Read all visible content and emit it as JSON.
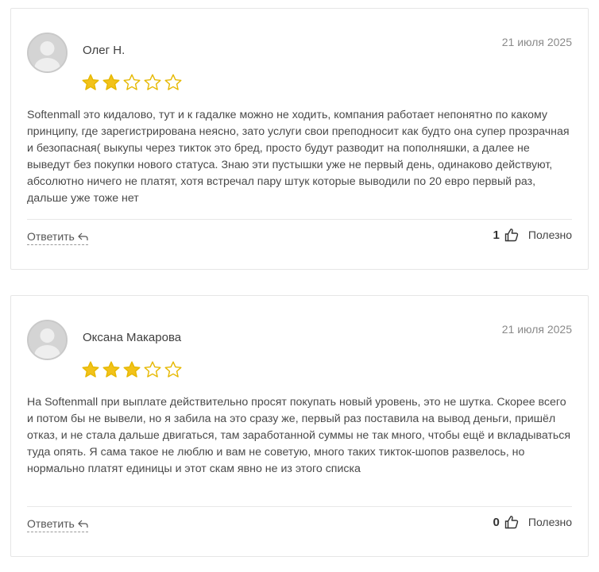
{
  "reviews": [
    {
      "author": "Олег Н.",
      "date": "21 июля 2025",
      "rating": 2,
      "max_rating": 5,
      "text": "Softenmall это кидалово, тут и к гадалке можно не ходить, компания работает непонятно по какому принципу, где зарегистрирована неясно, зато услуги свои преподносит как будто она супер прозрачная и безопасная( выкупы через тикток это бред, просто будут разводит на пополняшки, а далее не выведут без покупки нового статуса. Знаю эти пустышки уже не первый день, одинаково действуют, абсолютно ничего не платят, хотя встречал пару штук которые выводили по 20 евро первый раз, дальше уже тоже нет",
      "reply_label": "Ответить",
      "helpful_count": "1",
      "helpful_label": "Полезно"
    },
    {
      "author": "Оксана Макарова",
      "date": "21 июля 2025",
      "rating": 3,
      "max_rating": 5,
      "text": "На Softenmall при выплате действительно просят покупать новый уровень, это не шутка. Скорее всего и потом бы не вывели, но я забила на это сразу же, первый раз поставила на вывод деньги, пришёл отказ, и не стала дальше двигаться, там заработанной суммы не так много, чтобы ещё и вкладываться туда опять. Я сама такое не люблю и вам не советую, много таких тикток-шопов развелось, но нормально платят единицы и этот скам явно не из этого списка",
      "reply_label": "Ответить",
      "helpful_count": "0",
      "helpful_label": "Полезно"
    }
  ],
  "colors": {
    "star_filled": "#f2c21a",
    "star_outline": "#e6b800",
    "card_border": "#e6e6e6"
  },
  "icons": {
    "avatar": "user-silhouette-icon",
    "star": "star-icon",
    "reply": "reply-arrow-icon",
    "helpful": "thumbs-up-icon"
  }
}
